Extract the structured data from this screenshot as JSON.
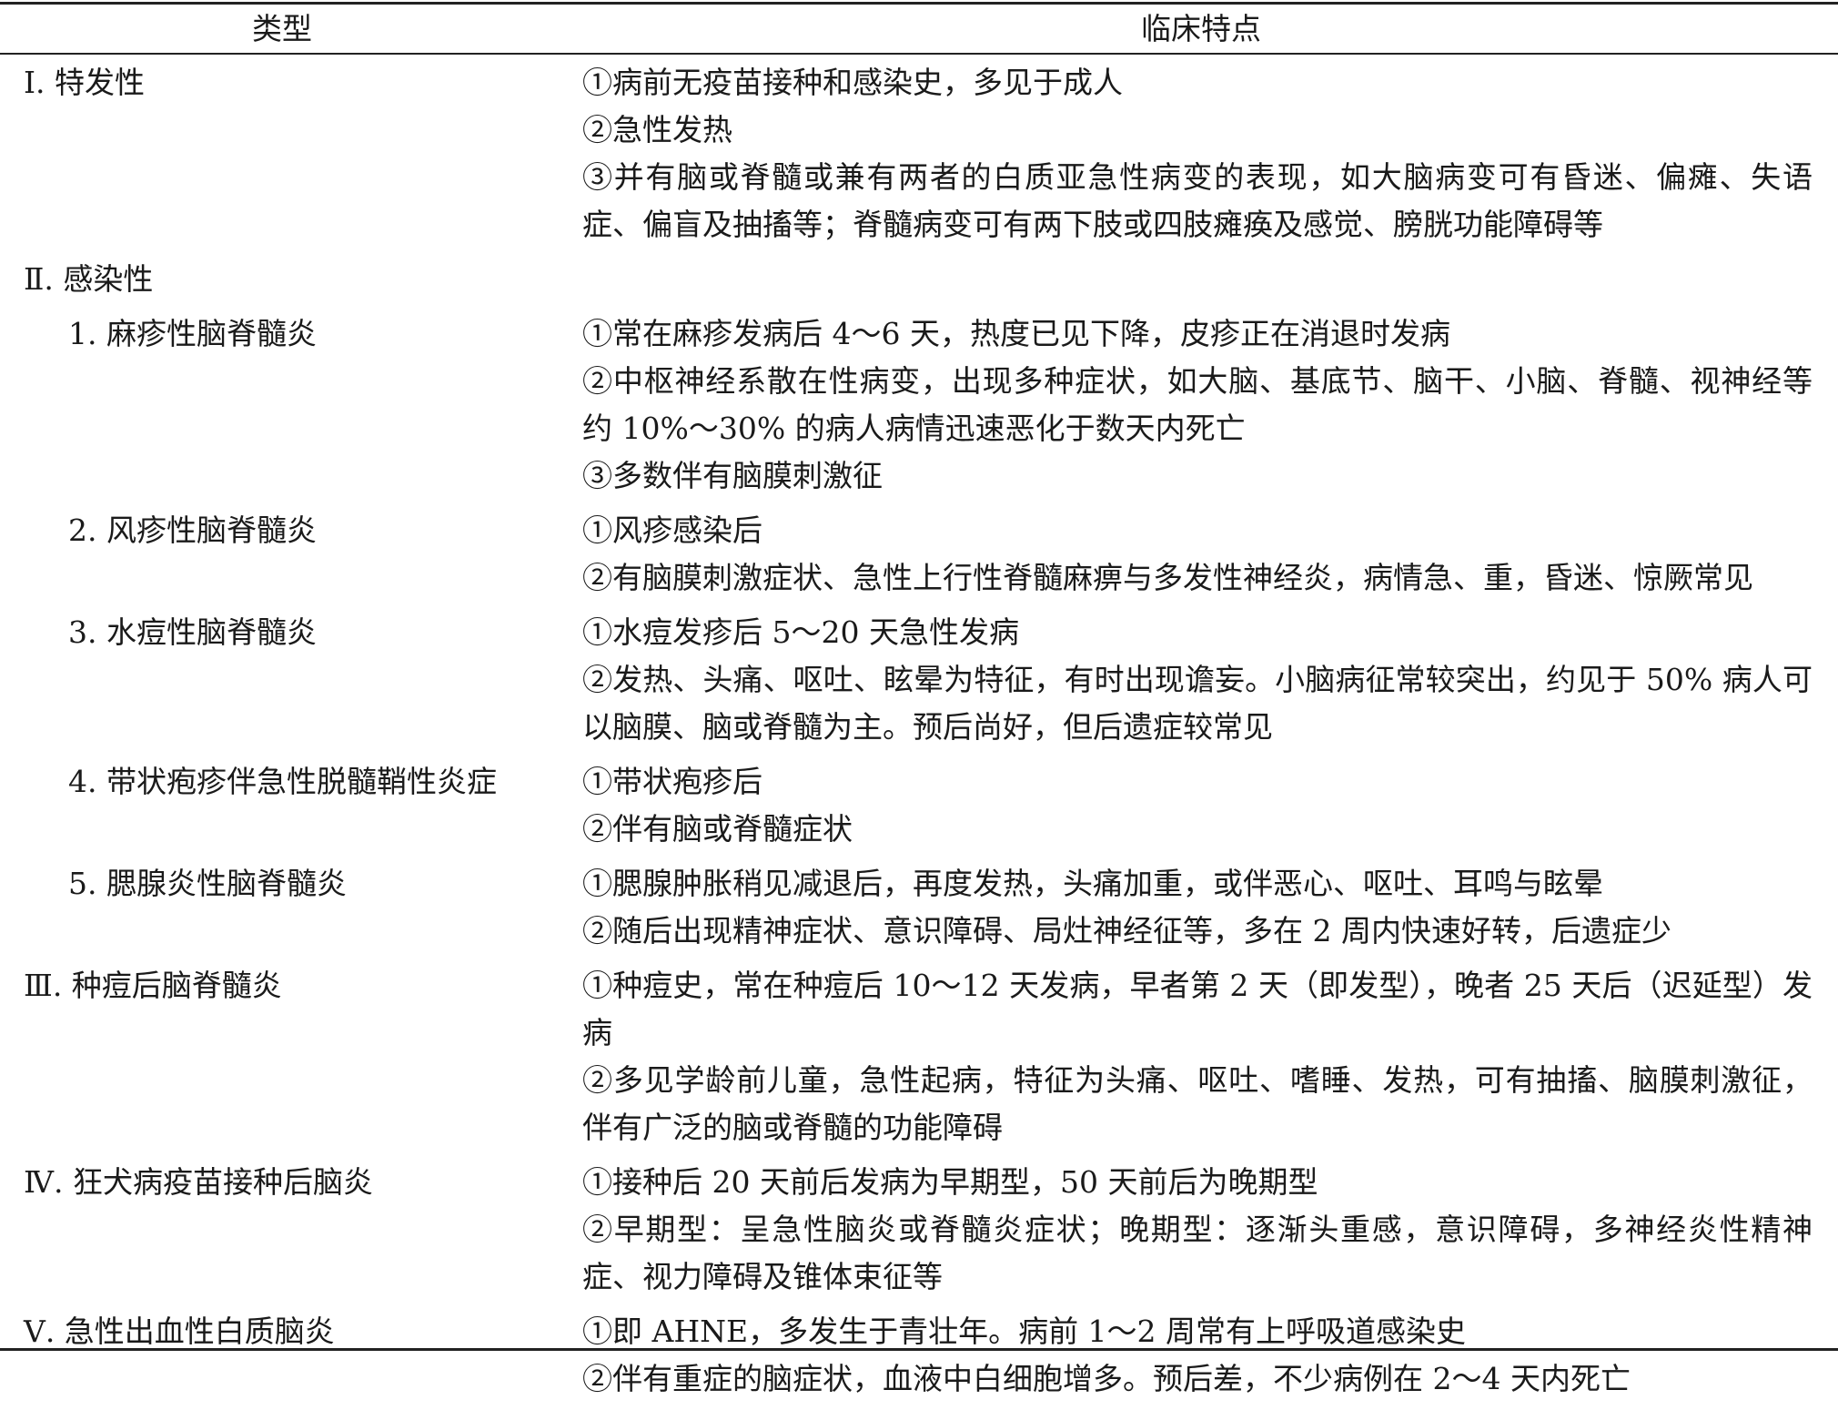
{
  "header": {
    "type": "类型",
    "clinical": "临床特点"
  },
  "rows": [
    {
      "type": "Ⅰ. 特发性",
      "level": 1,
      "lines": [
        "①病前无疫苗接种和感染史，多见于成人",
        "②急性发热",
        "③并有脑或脊髓或兼有两者的白质亚急性病变的表现，如大脑病变可有昏迷、偏瘫、失语症、偏盲及抽搐等；脊髓病变可有两下肢或四肢瘫痪及感觉、膀胱功能障碍等"
      ]
    },
    {
      "type": "Ⅱ. 感染性",
      "level": 1,
      "lines": []
    },
    {
      "type": "1. 麻疹性脑脊髓炎",
      "level": 2,
      "lines": [
        "①常在麻疹发病后 4～6 天，热度已见下降，皮疹正在消退时发病",
        "②中枢神经系散在性病变，出现多种症状，如大脑、基底节、脑干、小脑、脊髓、视神经等约 10%～30% 的病人病情迅速恶化于数天内死亡",
        "③多数伴有脑膜刺激征"
      ]
    },
    {
      "type": "2. 风疹性脑脊髓炎",
      "level": 2,
      "lines": [
        "①风疹感染后",
        "②有脑膜刺激症状、急性上行性脊髓麻痹与多发性神经炎，病情急、重，昏迷、惊厥常见"
      ]
    },
    {
      "type": "3. 水痘性脑脊髓炎",
      "level": 2,
      "lines": [
        "①水痘发疹后 5～20 天急性发病",
        "②发热、头痛、呕吐、眩晕为特征，有时出现谵妄。小脑病征常较突出，约见于 50% 病人可以脑膜、脑或脊髓为主。预后尚好，但后遗症较常见"
      ]
    },
    {
      "type": "4. 带状疱疹伴急性脱髓鞘性炎症",
      "level": 2,
      "lines": [
        "①带状疱疹后",
        "②伴有脑或脊髓症状"
      ]
    },
    {
      "type": "5. 腮腺炎性脑脊髓炎",
      "level": 2,
      "lines": [
        "①腮腺肿胀稍见减退后，再度发热，头痛加重，或伴恶心、呕吐、耳鸣与眩晕",
        "②随后出现精神症状、意识障碍、局灶神经征等，多在 2 周内快速好转，后遗症少"
      ]
    },
    {
      "type": "Ⅲ. 种痘后脑脊髓炎",
      "level": 1,
      "lines": [
        "①种痘史，常在种痘后 10～12 天发病，早者第 2 天（即发型），晚者 25 天后（迟延型）发病",
        "②多见学龄前儿童，急性起病，特征为头痛、呕吐、嗜睡、发热，可有抽搐、脑膜刺激征，伴有广泛的脑或脊髓的功能障碍"
      ]
    },
    {
      "type": "Ⅳ. 狂犬病疫苗接种后脑炎",
      "level": 1,
      "lines": [
        "①接种后 20 天前后发病为早期型，50 天前后为晚期型",
        "②早期型：呈急性脑炎或脊髓炎症状；晚期型：逐渐头重感，意识障碍，多神经炎性精神症、视力障碍及锥体束征等"
      ]
    },
    {
      "type": "Ⅴ. 急性出血性白质脑炎",
      "level": 1,
      "lines": [
        "①即 AHNE，多发生于青壮年。病前 1～2 周常有上呼吸道感染史",
        "②伴有重症的脑症状，血液中白细胞增多。预后差，不少病例在 2～4 天内死亡"
      ]
    }
  ]
}
